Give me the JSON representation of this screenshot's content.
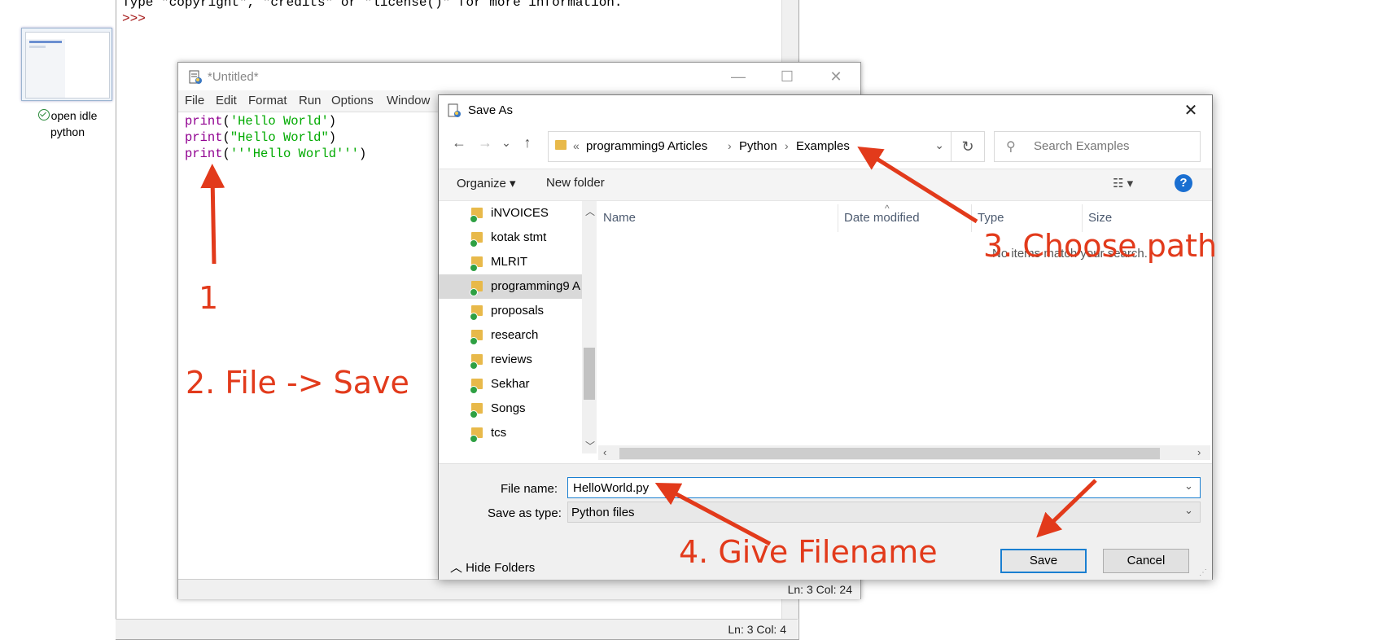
{
  "desktop": {
    "shortcut_label": "open idle python"
  },
  "shell": {
    "line1": "Type \"copyright\", \"credits\" or \"license()\" for more information.",
    "prompt": ">>>",
    "status": "Ln: 3   Col: 4"
  },
  "editor": {
    "title": "*Untitled*",
    "menu": [
      "File",
      "Edit",
      "Format",
      "Run",
      "Options",
      "Window"
    ],
    "code": [
      {
        "kw": "print",
        "open": "(",
        "str": "'Hello World'",
        "close": ")"
      },
      {
        "kw": "print",
        "open": "(",
        "str": "\"Hello World\"",
        "close": ")"
      },
      {
        "kw": "print",
        "open": "(",
        "str": "'''Hello World'''",
        "close": ")"
      }
    ],
    "status": "Ln: 3   Col: 24",
    "window_buttons": {
      "minimize": "—",
      "maximize": "☐",
      "close": "✕"
    }
  },
  "annotations": {
    "step1": "1",
    "step2": "2. File -> Save",
    "step3": "3. Choose path",
    "step4": "4. Give Filename"
  },
  "dialog": {
    "title": "Save As",
    "close": "✕",
    "nav": {
      "back": "←",
      "forward": "→",
      "recent": "⌄",
      "up": "↑"
    },
    "breadcrumb_overflow": "«",
    "breadcrumbs": [
      "programming9 Articles",
      "Python",
      "Examples"
    ],
    "breadcrumb_sep": "›",
    "refresh": "↻",
    "search_placeholder": "Search Examples",
    "organize": "Organize ▾",
    "new_folder": "New folder",
    "view": "☷ ▾",
    "help": "?",
    "tree": [
      "iNVOICES",
      "kotak stmt",
      "MLRIT",
      "programming9 A",
      "proposals",
      "research",
      "reviews",
      "Sekhar",
      "Songs",
      "tcs"
    ],
    "tree_selected": "programming9 A",
    "columns": [
      "Name",
      "Date modified",
      "Type",
      "Size"
    ],
    "empty_message": "No items match your search.",
    "file_name_label": "File name:",
    "file_name_value": "HelloWorld.py",
    "save_type_label": "Save as type:",
    "save_type_value": "Python files",
    "hide_folders": "Hide Folders",
    "save": "Save",
    "cancel": "Cancel"
  },
  "colors": {
    "annotation": "#e23a1b",
    "keyword": "#900090",
    "string": "#00aa00",
    "accent": "#1a7fd1"
  }
}
